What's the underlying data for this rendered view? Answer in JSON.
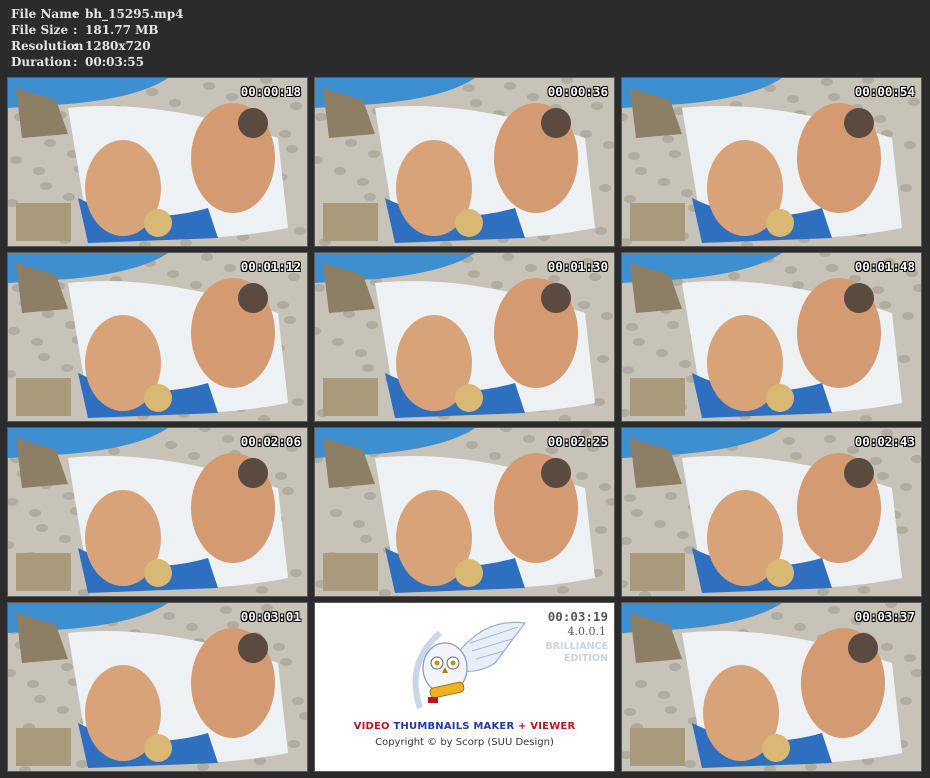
{
  "file_info": {
    "rows": [
      {
        "key": "File Name",
        "sep": ":",
        "value": "bh_15295.mp4"
      },
      {
        "key": "File Size",
        "sep": ":",
        "value": "181.77 MB"
      },
      {
        "key": "Resolution",
        "sep": ":",
        "value": "1280x720"
      },
      {
        "key": "Duration",
        "sep": ":",
        "value": "00:03:55"
      }
    ]
  },
  "thumbnails": [
    {
      "timestamp": "00:00:18"
    },
    {
      "timestamp": "00:00:36"
    },
    {
      "timestamp": "00:00:54"
    },
    {
      "timestamp": "00:01:12"
    },
    {
      "timestamp": "00:01:30"
    },
    {
      "timestamp": "00:01:48"
    },
    {
      "timestamp": "00:02:06"
    },
    {
      "timestamp": "00:02:25"
    },
    {
      "timestamp": "00:02:43"
    },
    {
      "timestamp": "00:03:01"
    },
    {
      "timestamp": "00:03:19"
    },
    {
      "timestamp": "00:03:37"
    }
  ],
  "logo": {
    "version": "4.0.0.1",
    "edition_line1": "BRILLIANCE",
    "edition_line2": "EDITION",
    "title_part1": "VIDEO",
    "title_part2": "THUMBNAILS MAKER",
    "title_part3": "+ VIEWER",
    "copyright": "Copyright © by Scorp (SUU Design)"
  },
  "colors": {
    "background": "#2b2b2b",
    "meta_text": "#e6e6e6",
    "logo_red": "#c0141c",
    "logo_blue": "#1c3aa8",
    "umbrella_blue": "#3d8fd0",
    "towel_blue": "#2f6fc0"
  }
}
